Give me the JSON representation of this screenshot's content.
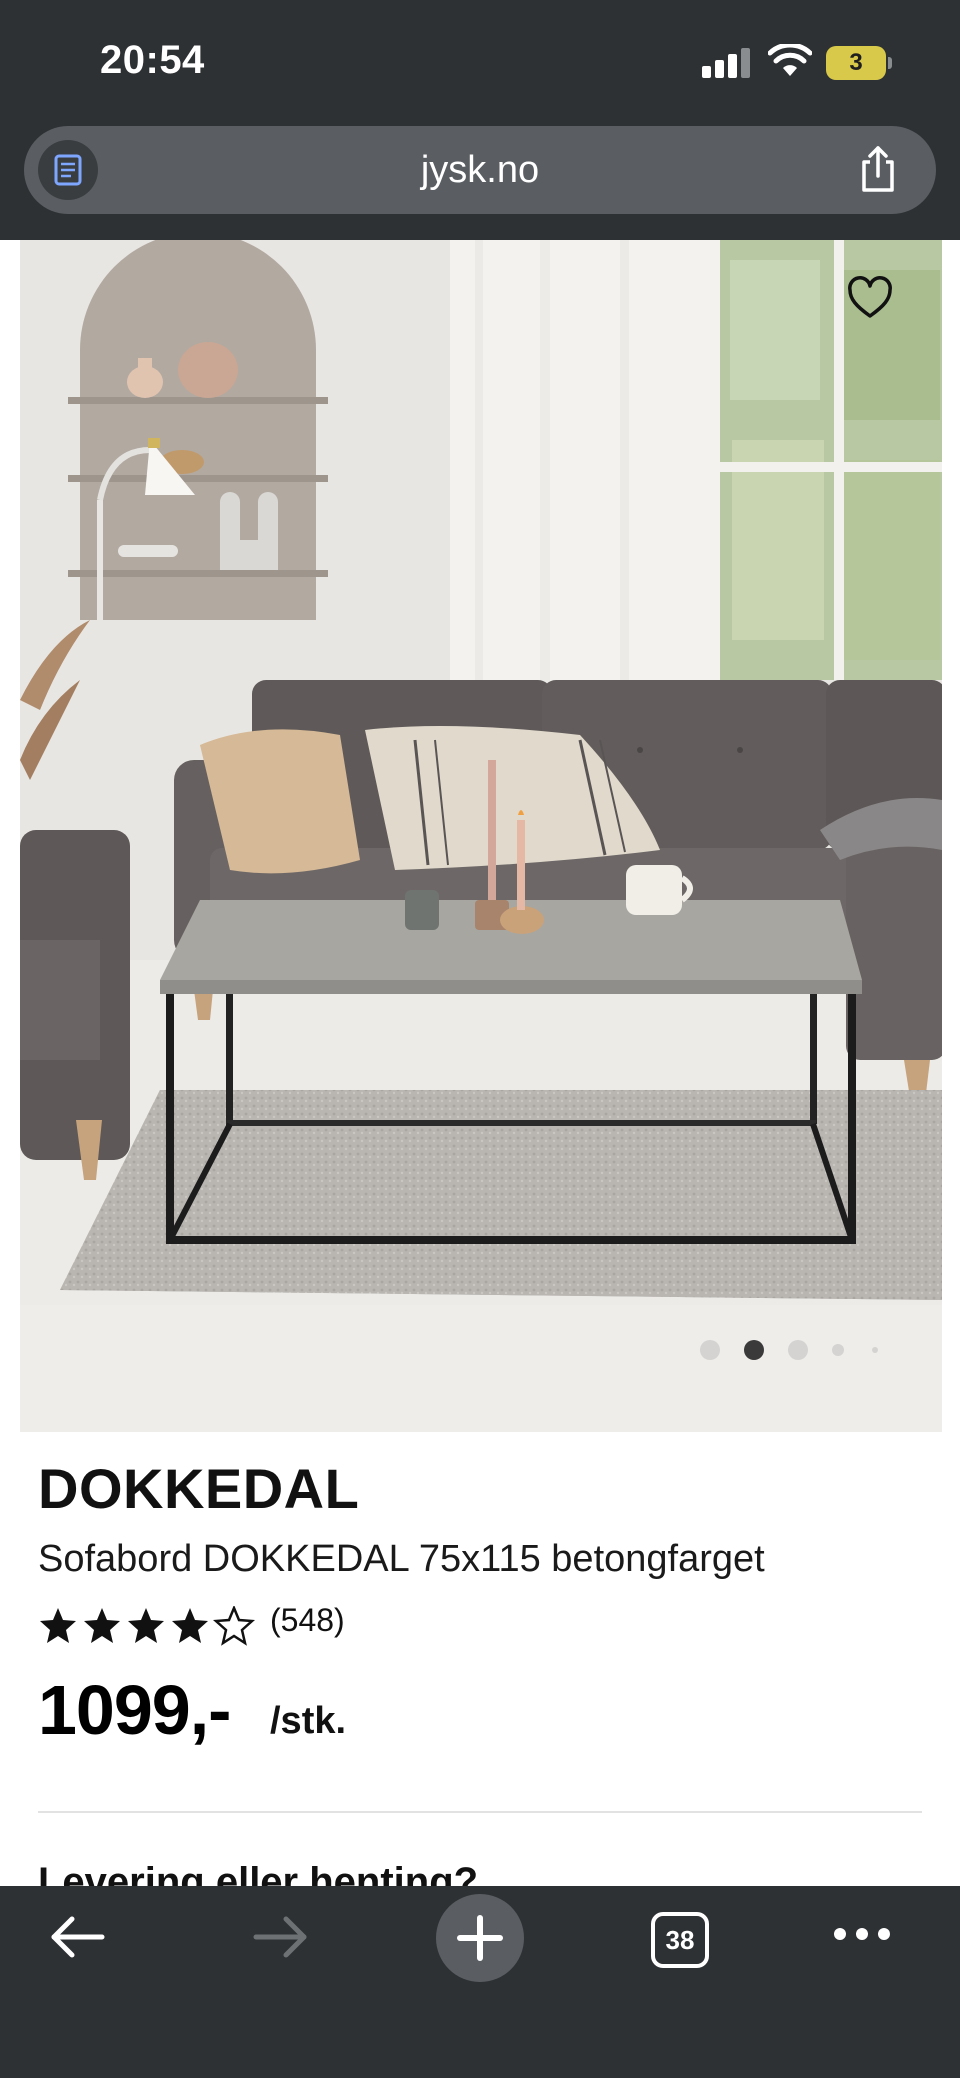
{
  "status_bar": {
    "time": "20:54",
    "battery_level": "3",
    "signal_bars_active": 3,
    "signal_bars_total": 4
  },
  "browser": {
    "url": "jysk.no",
    "reader_icon": "reader-mode-icon",
    "share_icon": "share-icon",
    "open_tabs_count": "38"
  },
  "product": {
    "name": "DOKKEDAL",
    "description": "Sofabord DOKKEDAL 75x115 betongfarget",
    "rating_stars": 4,
    "rating_max": 5,
    "review_count": "(548)",
    "price": "1099,-",
    "price_unit": "/stk.",
    "next_section_heading": "Levering eller henting?"
  },
  "gallery": {
    "dot_count": 5,
    "active_dot_index": 1,
    "favorite_icon": "heart-outline-icon"
  },
  "bottom_toolbar": {
    "back_icon": "arrow-left-icon",
    "forward_icon": "arrow-right-icon",
    "new_tab_icon": "plus-icon",
    "tabs_icon": "tabs-icon",
    "more_icon": "more-dots-icon"
  },
  "colors": {
    "browser_chrome": "#2e3134",
    "url_pill": "#5a5e62",
    "battery": "#d9c94a"
  }
}
